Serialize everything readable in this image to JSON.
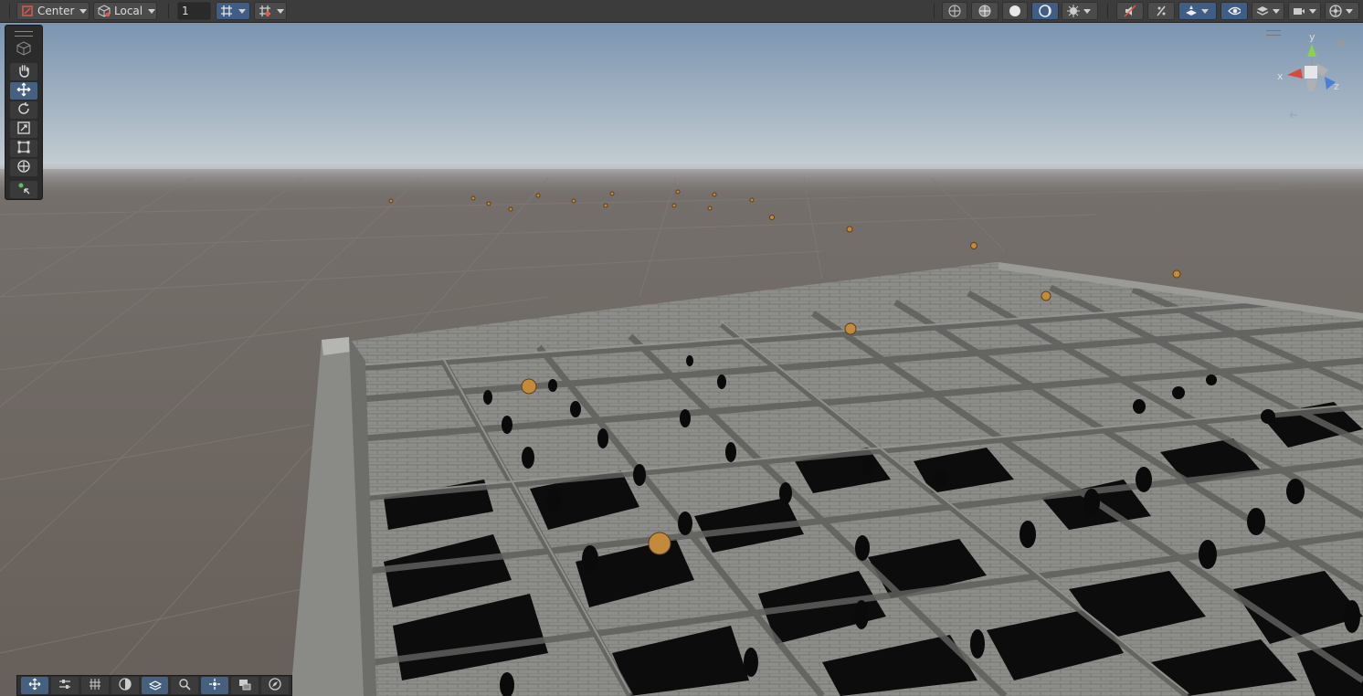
{
  "toolbar": {
    "pivot_label": "Center",
    "space_label": "Local",
    "snap_increment": "1",
    "left_icons": [
      "grid-snap-icon",
      "snap-settings-icon"
    ],
    "right_icons": [
      "wireframe-icon",
      "shaded-wireframe-icon",
      "shaded-icon",
      "lighting-icon",
      "effects-icon",
      "audio-mute-icon",
      "fx-icon",
      "gizmos-toggle-icon",
      "visibility-icon",
      "layers-icon",
      "camera-icon",
      "globe-icon"
    ]
  },
  "tools_panel": {
    "items": [
      "view-tool",
      "hand-tool",
      "move-tool",
      "rotate-tool",
      "scale-tool",
      "rect-tool",
      "transform-tool",
      "custom-tool"
    ],
    "active": "move-tool"
  },
  "gizmo": {
    "x_label": "x",
    "y_label": "y",
    "z_label": "z"
  },
  "bottom_overlay": {
    "items": [
      "move-overlay-icon",
      "settings-overlay-icon",
      "grid-overlay-icon",
      "shading-overlay-icon",
      "navmesh-overlay-icon",
      "search-overlay-icon",
      "pivot-overlay-icon",
      "camera-overlay-icon",
      "compass-overlay-icon"
    ]
  },
  "colors": {
    "accent": "#46607f",
    "toolbar_bg": "#3c3c3c",
    "sky_top": "#7d96b2",
    "ground": "#6b645e",
    "wall": "#8e8f8b"
  }
}
